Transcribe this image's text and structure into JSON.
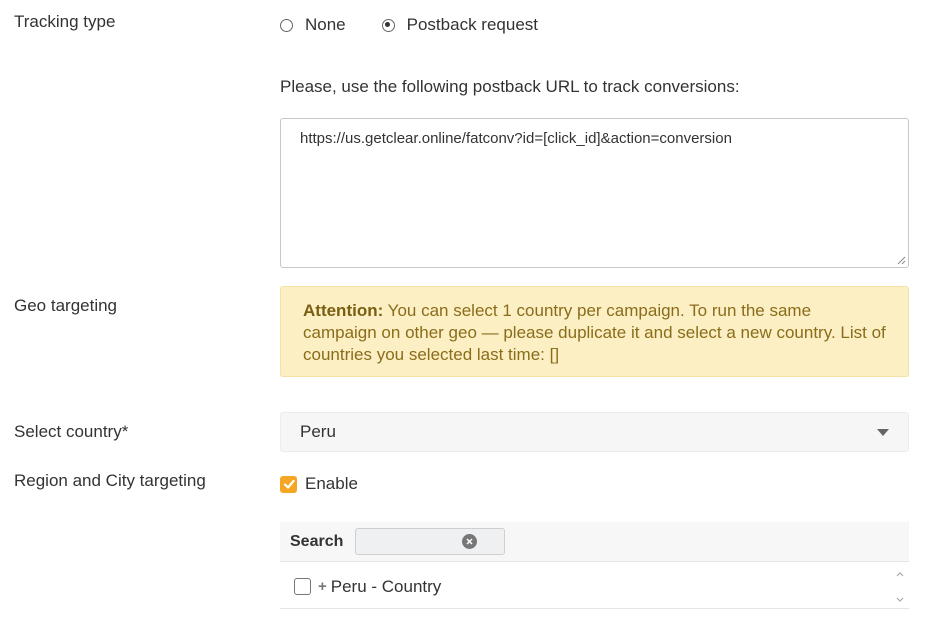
{
  "tracking": {
    "label": "Tracking type",
    "options": [
      {
        "label": "None",
        "selected": false
      },
      {
        "label": "Postback request",
        "selected": true
      }
    ],
    "postback_note": "Please, use the following postback URL to track conversions:",
    "postback_url": "https://us.getclear.online/fatconv?id=[click_id]&action=conversion"
  },
  "geo": {
    "label": "Geo targeting",
    "attention_strong": "Attention:",
    "attention_text": " You can select 1 country per campaign. To run the same campaign on other geo — please duplicate it and select a new country. List of countries you selected last time: []",
    "attention_colors": {
      "background": "#fcefc4",
      "text": "#8a6d1a"
    }
  },
  "country": {
    "label": "Select country*",
    "selected": "Peru",
    "icon": "chevron-down-icon"
  },
  "region": {
    "label": "Region and City targeting",
    "enable_label": "Enable",
    "enabled": true,
    "accent_color": "#f5a623",
    "search_label": "Search",
    "search_value": "",
    "tree_items": [
      {
        "label": "Peru - Country",
        "checked": false,
        "icon": "plus-icon"
      }
    ]
  }
}
